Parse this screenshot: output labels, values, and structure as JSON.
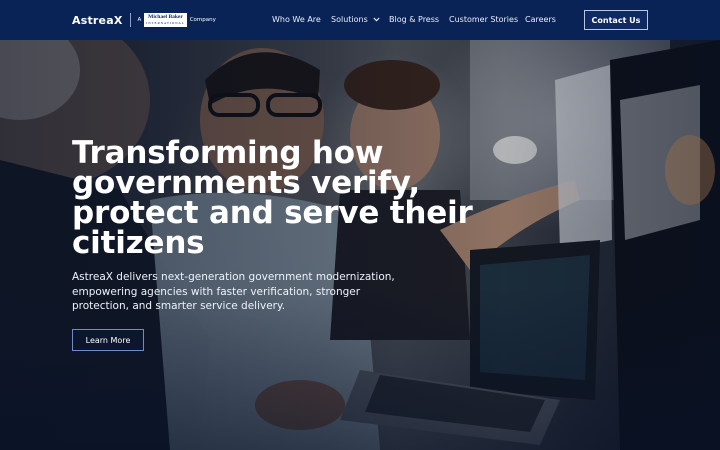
{
  "header": {
    "logo": {
      "wordmark": "AstreaX",
      "tagline_prefix": "A",
      "partner_name": "Michael Baker",
      "partner_sub": "INTERNATIONAL",
      "tagline_suffix": "Company"
    },
    "nav": [
      {
        "label": "Who We Are"
      },
      {
        "label": "Solutions",
        "has_dropdown": true
      },
      {
        "label": "Blog & Press"
      },
      {
        "label": "Customer Stories"
      },
      {
        "label": "Careers"
      }
    ],
    "contact_label": "Contact Us"
  },
  "hero": {
    "headline": "Transforming how governments verify, protect and serve their citizens",
    "subtext": "AstreaX delivers next-generation government modernization, empowering agencies with faster verification, stronger protection, and smarter service delivery.",
    "cta_label": "Learn More"
  },
  "colors": {
    "header_bg": "#0a2357",
    "accent_border": "#6d8cc9",
    "text": "#ffffff"
  }
}
